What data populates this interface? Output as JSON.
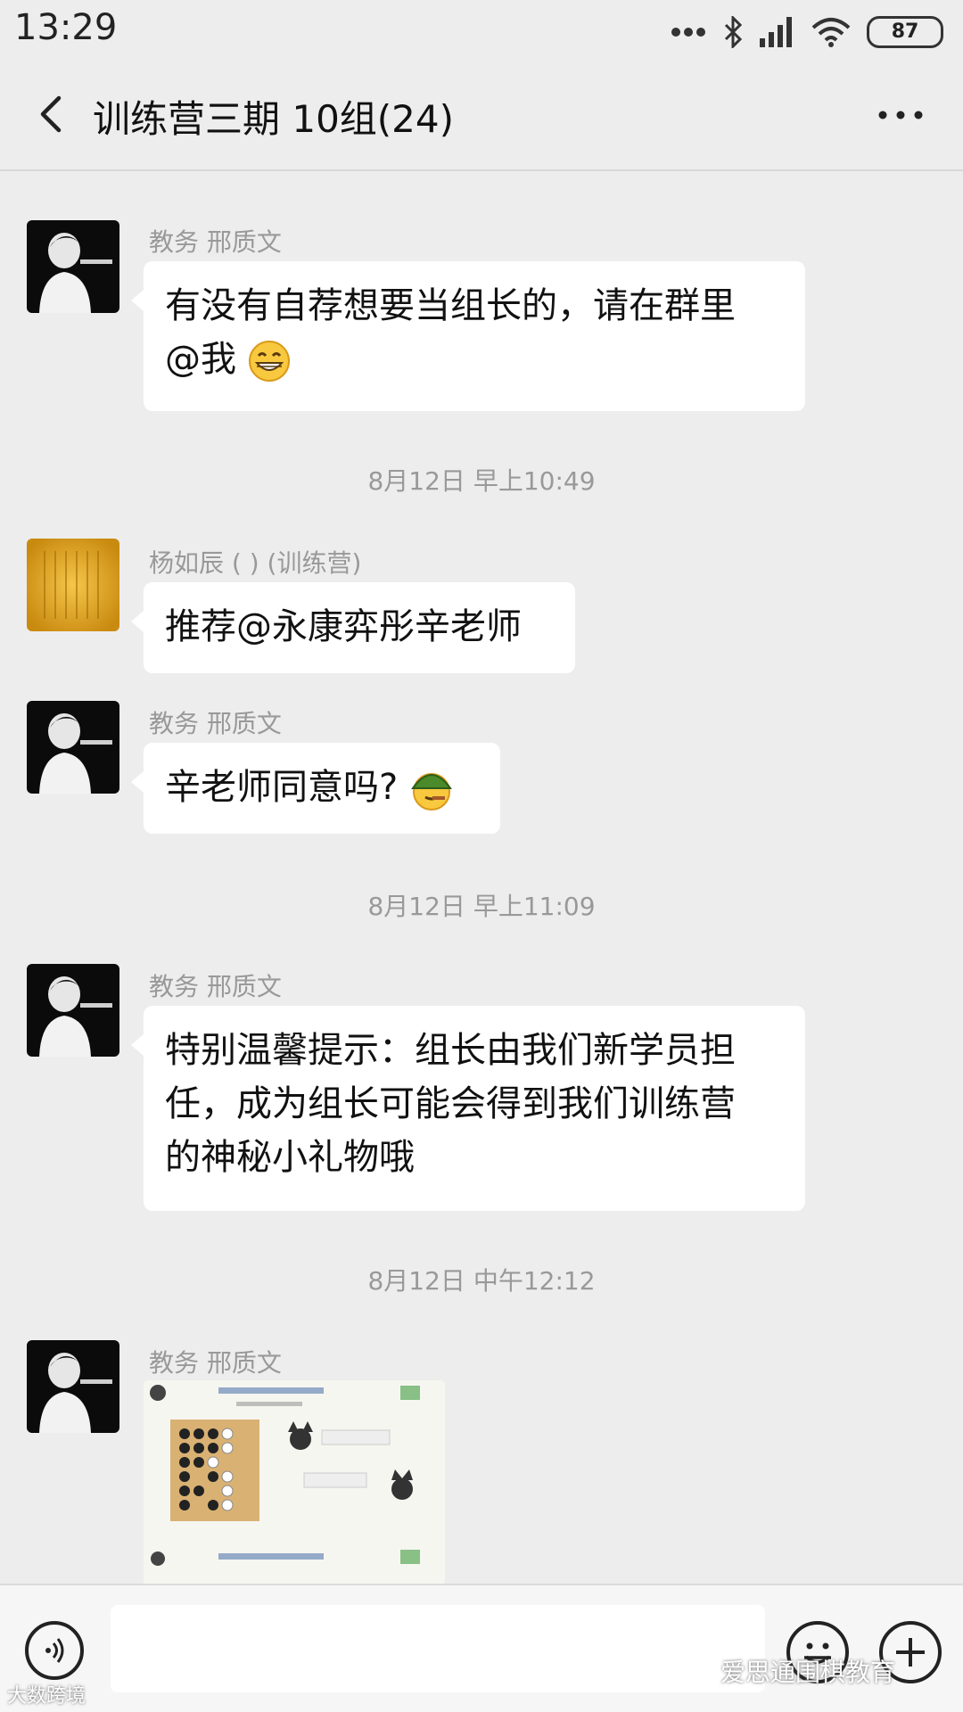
{
  "status_bar": {
    "time": "13:29",
    "battery": "87",
    "icons": [
      "dots-icon",
      "bluetooth-icon",
      "signal-icon",
      "wifi-icon",
      "battery-icon"
    ]
  },
  "header": {
    "title": "训练营三期 10组(24)",
    "back_icon": "back-chevron-icon",
    "more_icon": "more-dots-icon"
  },
  "messages": [
    {
      "sender": "教务 邢质文",
      "lines": [
        "有没有自荐想要当组长的，请在群里",
        "@我"
      ],
      "emoji": "grin-emoji"
    },
    {
      "timestamp": "8月12日 早上10:49"
    },
    {
      "sender": "杨如辰 ( ) (训练营)",
      "lines": [
        "推荐@永康弈彤辛老师"
      ]
    },
    {
      "sender": "教务 邢质文",
      "lines": [
        "辛老师同意吗?"
      ],
      "emoji": "helmet-emoji"
    },
    {
      "timestamp": "8月12日 早上11:09"
    },
    {
      "sender": "教务 邢质文",
      "lines": [
        "特别温馨提示：组长由我们新学员担",
        "任，成为组长可能会得到我们训练营",
        "的神秘小礼物哦"
      ]
    },
    {
      "timestamp": "8月12日 中午12:12"
    },
    {
      "sender": "教务 邢质文",
      "image": "shared-image-thumbnail"
    }
  ],
  "input_bar": {
    "voice_icon": "voice-icon",
    "emoji_icon": "emoji-smile-icon",
    "plus_icon": "plus-icon",
    "input_value": ""
  },
  "watermarks": {
    "left": "大数跨境",
    "right": "爱思通围棋教育"
  }
}
